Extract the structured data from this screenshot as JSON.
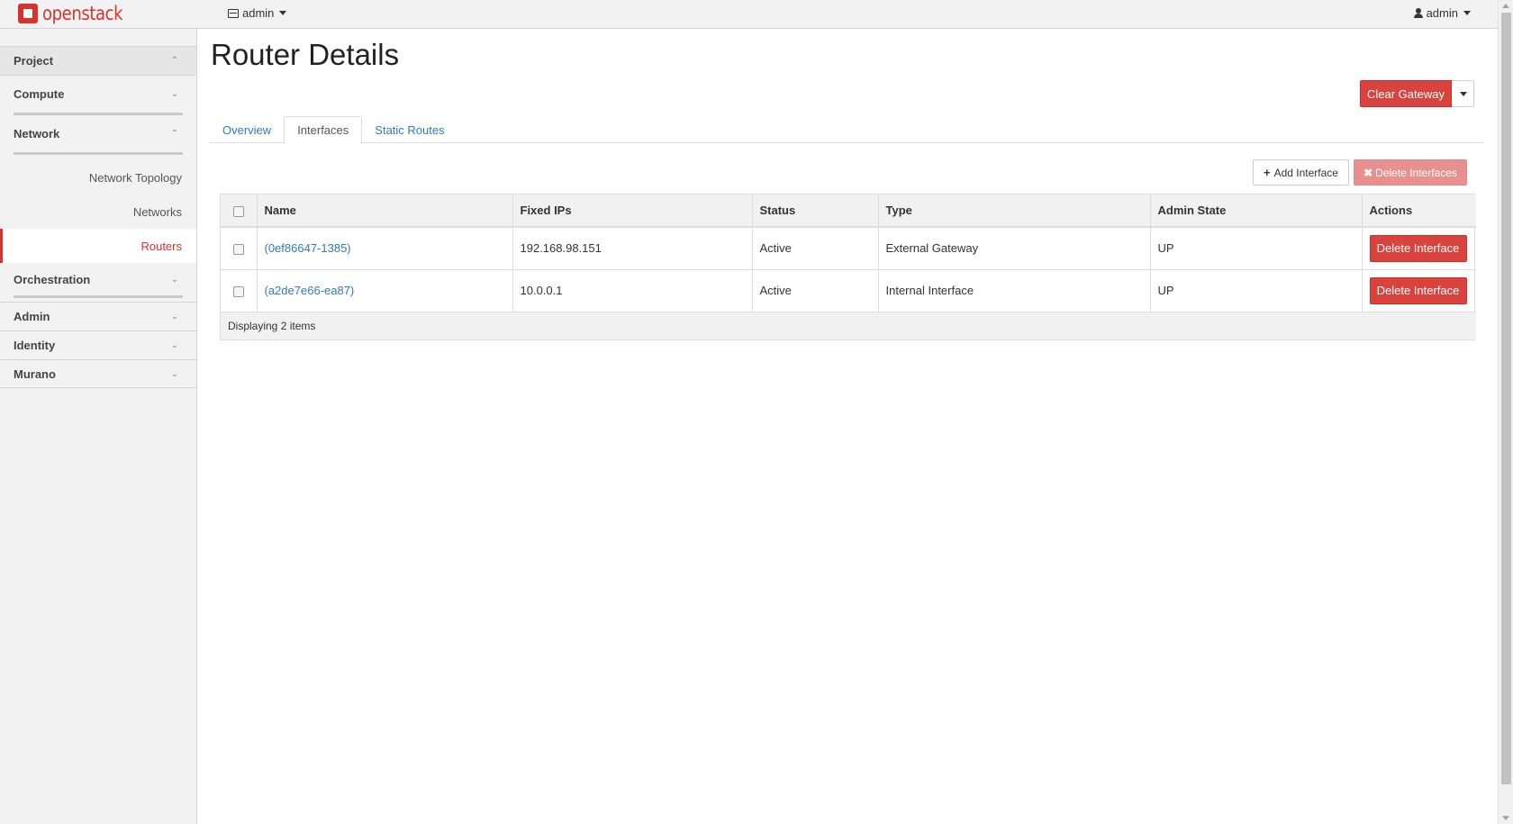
{
  "brand": {
    "logo_text": "openstack",
    "color": "#d6322e"
  },
  "topbar": {
    "project_switcher": {
      "label": "admin",
      "icon": "server-icon"
    },
    "user_menu": {
      "label": "admin",
      "icon": "user-icon"
    }
  },
  "sidebar": {
    "project": "Project",
    "compute": "Compute",
    "network": "Network",
    "network_items": [
      {
        "label": "Network Topology"
      },
      {
        "label": "Networks"
      },
      {
        "label": "Routers",
        "active": true
      }
    ],
    "orchestration": "Orchestration",
    "admin": "Admin",
    "identity": "Identity",
    "murano": "Murano"
  },
  "page": {
    "title": "Router Details",
    "clear_gateway_label": "Clear Gateway",
    "tabs": [
      {
        "label": "Overview"
      },
      {
        "label": "Interfaces",
        "active": true
      },
      {
        "label": "Static Routes"
      }
    ],
    "add_interface_label": "Add Interface",
    "delete_interfaces_label": "Delete Interfaces"
  },
  "interfaces_table": {
    "columns": [
      "Name",
      "Fixed IPs",
      "Status",
      "Type",
      "Admin State",
      "Actions"
    ],
    "rows": [
      {
        "name": "(0ef86647-1385)",
        "fixed_ips": "192.168.98.151",
        "status": "Active",
        "type": "External Gateway",
        "admin_state": "UP",
        "action": "Delete Interface"
      },
      {
        "name": "(a2de7e66-ea87)",
        "fixed_ips": "10.0.0.1",
        "status": "Active",
        "type": "Internal Interface",
        "admin_state": "UP",
        "action": "Delete Interface"
      }
    ],
    "footer": "Displaying 2 items"
  }
}
